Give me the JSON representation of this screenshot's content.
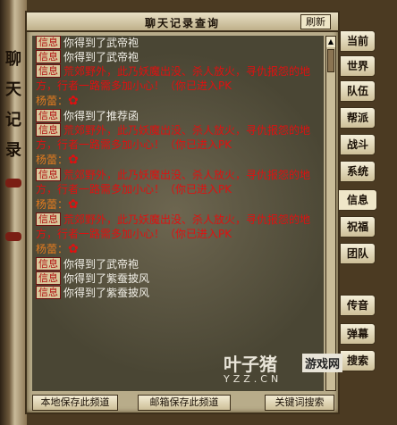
{
  "window": {
    "title": "聊天记录查询",
    "refresh_label": "刷新"
  },
  "scroll_text": [
    "聊",
    "天",
    "记",
    "录"
  ],
  "messages": [
    {
      "kind": "tag",
      "tag": "信息",
      "text": "你得到了武帝袍",
      "color": "white"
    },
    {
      "kind": "tag",
      "tag": "信息",
      "text": "你得到了武帝袍",
      "color": "white"
    },
    {
      "kind": "tag",
      "tag": "信息",
      "text": "荒郊野外，此乃妖魔出没、杀人放火，寻仇报怨的地方，行者一路需多加小心！（你已进入PK",
      "color": "red"
    },
    {
      "kind": "speaker",
      "text": "杨蕾："
    },
    {
      "kind": "tag",
      "tag": "信息",
      "text": "你得到了推荐函",
      "color": "white"
    },
    {
      "kind": "tag",
      "tag": "信息",
      "text": "荒郊野外，此乃妖魔出没、杀人放火，寻仇报怨的地方，行者一路需多加小心！（你已进入PK",
      "color": "red"
    },
    {
      "kind": "speaker",
      "text": "杨蕾："
    },
    {
      "kind": "tag",
      "tag": "信息",
      "text": "荒郊野外，此乃妖魔出没、杀人放火，寻仇报怨的地方，行者一路需多加小心！（你已进入PK",
      "color": "red"
    },
    {
      "kind": "speaker",
      "text": "杨蕾："
    },
    {
      "kind": "tag",
      "tag": "信息",
      "text": "荒郊野外，此乃妖魔出没、杀人放火，寻仇报怨的地方，行者一路需多加小心！（你已进入PK",
      "color": "red"
    },
    {
      "kind": "speaker",
      "text": "杨蕾："
    },
    {
      "kind": "tag",
      "tag": "信息",
      "text": "你得到了武帝袍",
      "color": "white"
    },
    {
      "kind": "tag",
      "tag": "信息",
      "text": "你得到了紫蚕披风",
      "color": "white"
    },
    {
      "kind": "tag",
      "tag": "信息",
      "text": "你得到了紫蚕披风",
      "color": "white"
    }
  ],
  "bottom_buttons": [
    "本地保存此频道",
    "邮箱保存此频道",
    "关键词搜索"
  ],
  "tabs": [
    "当前",
    "世界",
    "队伍",
    "帮派",
    "战斗",
    "系统",
    "信息",
    "祝福",
    "团队",
    "传音",
    "弹幕",
    "搜索"
  ],
  "active_tab": "信息",
  "watermark": {
    "main": "叶子猪",
    "box": "游戏网",
    "sub": "YZZ.CN"
  },
  "colors": {
    "message_red": "#e01010",
    "message_white": "#f2f0e8",
    "speaker": "#e07a20",
    "panel_bg": "#b8ac8a",
    "chat_bg": "#4a4634"
  }
}
